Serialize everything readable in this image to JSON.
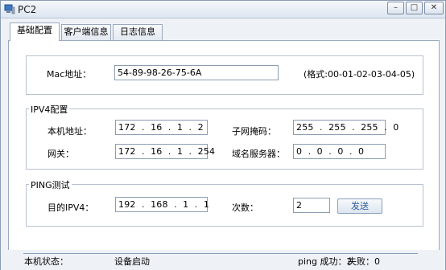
{
  "window": {
    "title": "PC2"
  },
  "window_controls": {
    "minimize": "–",
    "maximize": "□",
    "close": "✕"
  },
  "tabs": [
    {
      "label": "基础配置",
      "active": true
    },
    {
      "label": "客户端信息",
      "active": false
    },
    {
      "label": "日志信息",
      "active": false
    }
  ],
  "mac": {
    "label": "Mac地址：",
    "value": "54-89-98-26-75-6A",
    "hint": "(格式:00-01-02-03-04-05)"
  },
  "ipv4": {
    "legend": "IPV4配置",
    "ip_label": "本机地址：",
    "ip_value": "172  .  16  .  1  .  2",
    "mask_label": "子网掩码：",
    "mask_value": "255  .  255  .  255  .  0",
    "gateway_label": "网关：",
    "gateway_value": "172  .  16  .  1  .  254",
    "dns_label": "域名服务器：",
    "dns_value": "0  .  0  .  0  .  0"
  },
  "ping": {
    "legend": "PING测试",
    "dest_label": "目的IPV4：",
    "dest_value": "192  .  168  .  1  .  1",
    "count_label": "次数：",
    "count_value": "2",
    "send_label": "发送"
  },
  "status": {
    "label": "本机状态：",
    "value": "设备启动",
    "ping_success": "ping 成功：2",
    "fail": "失败：0"
  },
  "colors": {
    "accent": "#2a5a9c",
    "border": "#8c9db3"
  }
}
